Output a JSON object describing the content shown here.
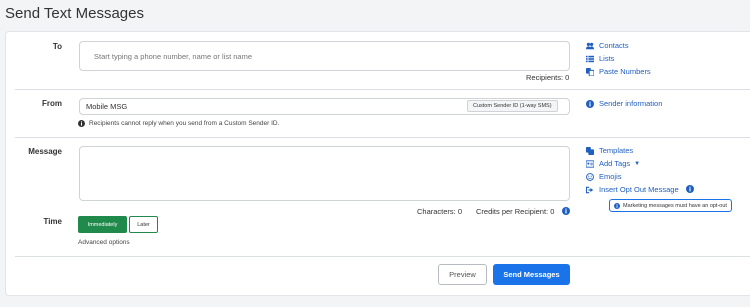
{
  "page": {
    "title": "Send Text Messages"
  },
  "to": {
    "label": "To",
    "placeholder": "Start typing a phone number, name or list name",
    "recipients": "Recipients: 0",
    "links": {
      "contacts": "Contacts",
      "lists": "Lists",
      "paste": "Paste Numbers"
    }
  },
  "from": {
    "label": "From",
    "value": "Mobile MSG",
    "tag": "Custom Sender ID (1-way SMS)",
    "note": "Recipients cannot reply when you send from a Custom Sender ID.",
    "link": "Sender information"
  },
  "message": {
    "label": "Message",
    "characters": "Characters: 0",
    "credits": "Credits per Recipient: 0",
    "links": {
      "templates": "Templates",
      "add_tags": "Add Tags",
      "emojis": "Emojis",
      "opt_out": "Insert Opt Out Message"
    },
    "tooltip": "Marketing messages must have an opt-out"
  },
  "time": {
    "label": "Time",
    "immediately": "Immediately",
    "later": "Later",
    "advanced": "Advanced options"
  },
  "actions": {
    "preview": "Preview",
    "send": "Send Messages"
  },
  "colors": {
    "accent": "#1a73e8",
    "link": "#1f5fbf",
    "green": "#1f8a4c"
  }
}
